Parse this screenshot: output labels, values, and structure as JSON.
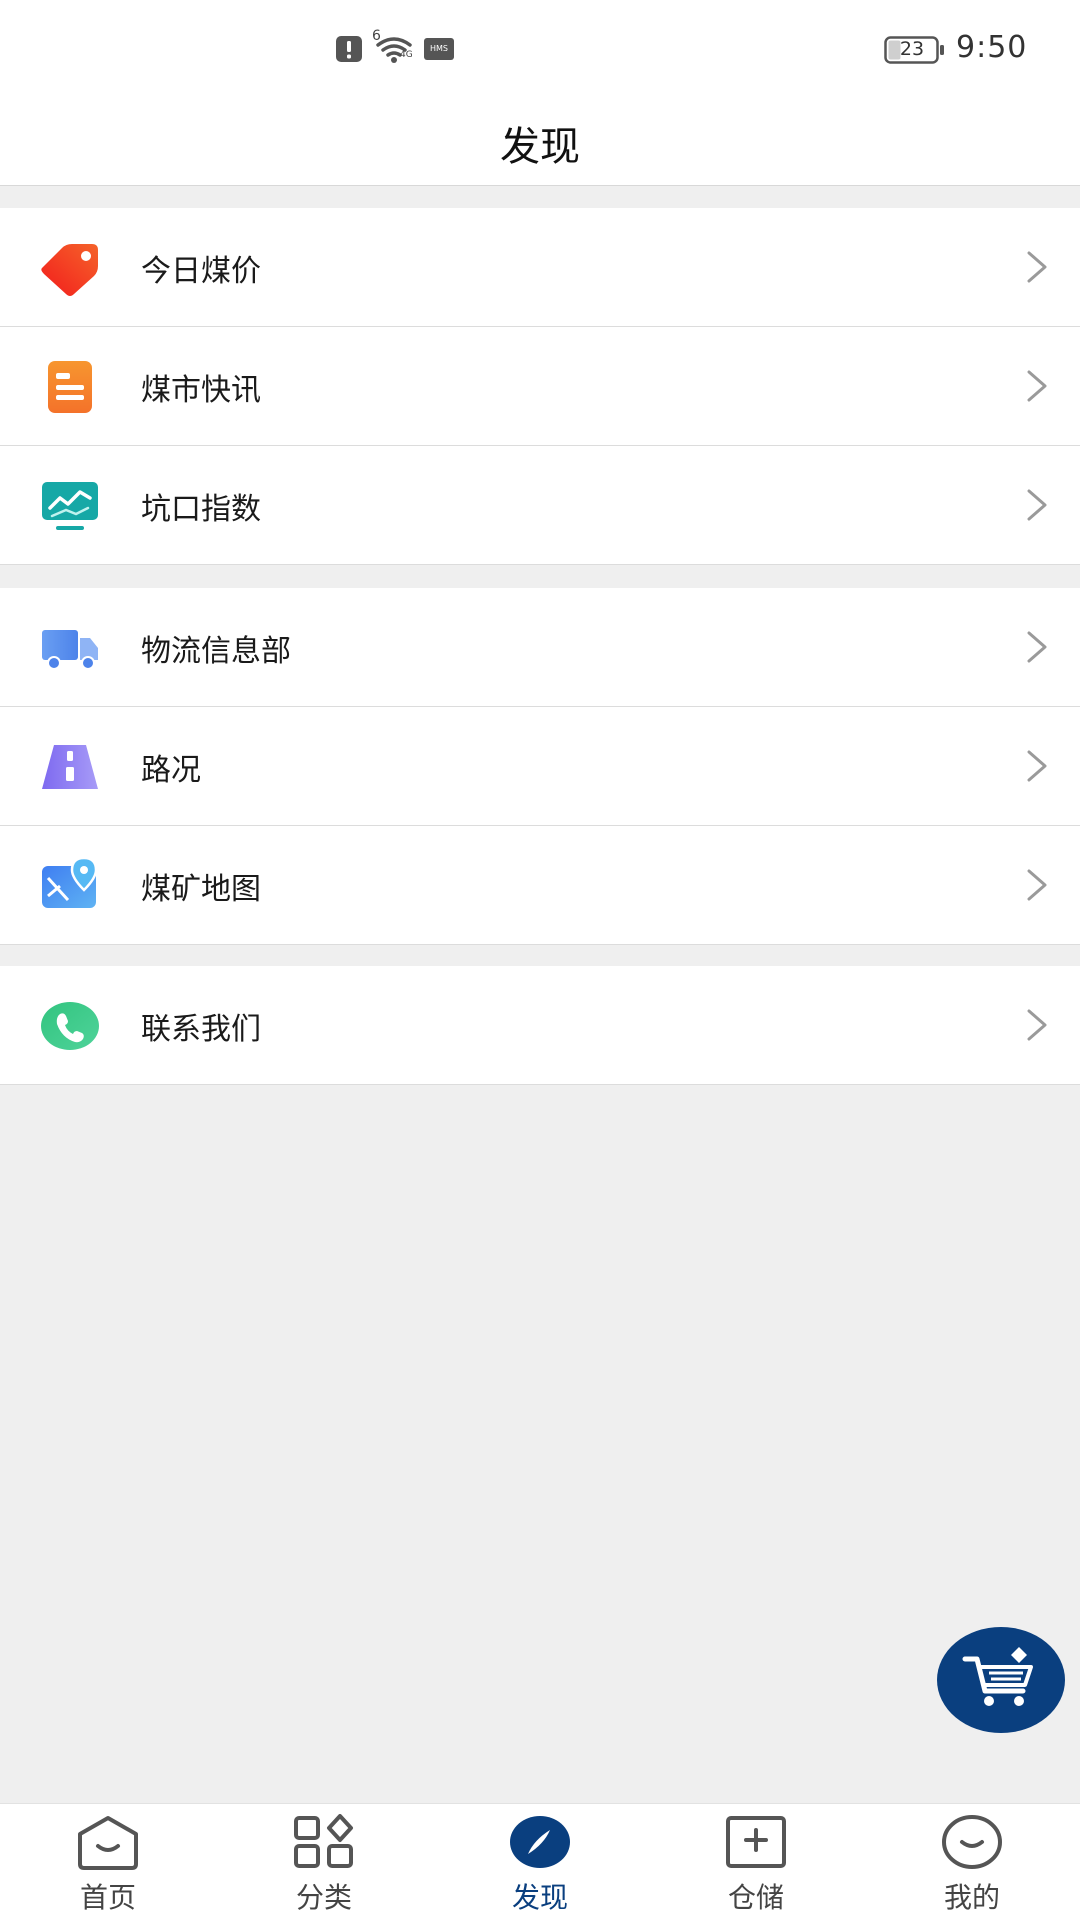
{
  "status_bar": {
    "signal_label": "6",
    "network_label": "4G",
    "hms_label": "HMS",
    "battery_level": "23",
    "time": "9:50"
  },
  "header": {
    "title": "发现"
  },
  "groups": [
    {
      "items": [
        {
          "label": "今日煤价",
          "icon": "price-tag-icon",
          "color": "#f0441c"
        },
        {
          "label": "煤市快讯",
          "icon": "news-icon",
          "color": "#f5822a"
        },
        {
          "label": "坑口指数",
          "icon": "index-chart-icon",
          "color": "#1aa9a8"
        }
      ]
    },
    {
      "items": [
        {
          "label": "物流信息部",
          "icon": "truck-icon",
          "color": "#5b92ef"
        },
        {
          "label": "路况",
          "icon": "road-icon",
          "color": "#8a7cf0"
        },
        {
          "label": "煤矿地图",
          "icon": "map-pin-icon",
          "color": "#3f8cf2"
        }
      ]
    },
    {
      "items": [
        {
          "label": "联系我们",
          "icon": "phone-icon",
          "color": "#36c785"
        }
      ]
    }
  ],
  "fab": {
    "icon": "shopping-cart-icon",
    "color": "#0a3f7f"
  },
  "tabbar": {
    "active_color": "#0a3f7f",
    "tabs": [
      {
        "label": "首页",
        "icon": "home-icon"
      },
      {
        "label": "分类",
        "icon": "category-grid-icon"
      },
      {
        "label": "发现",
        "icon": "compass-icon",
        "active": true
      },
      {
        "label": "仓储",
        "icon": "storage-box-icon"
      },
      {
        "label": "我的",
        "icon": "profile-smile-icon"
      }
    ]
  }
}
